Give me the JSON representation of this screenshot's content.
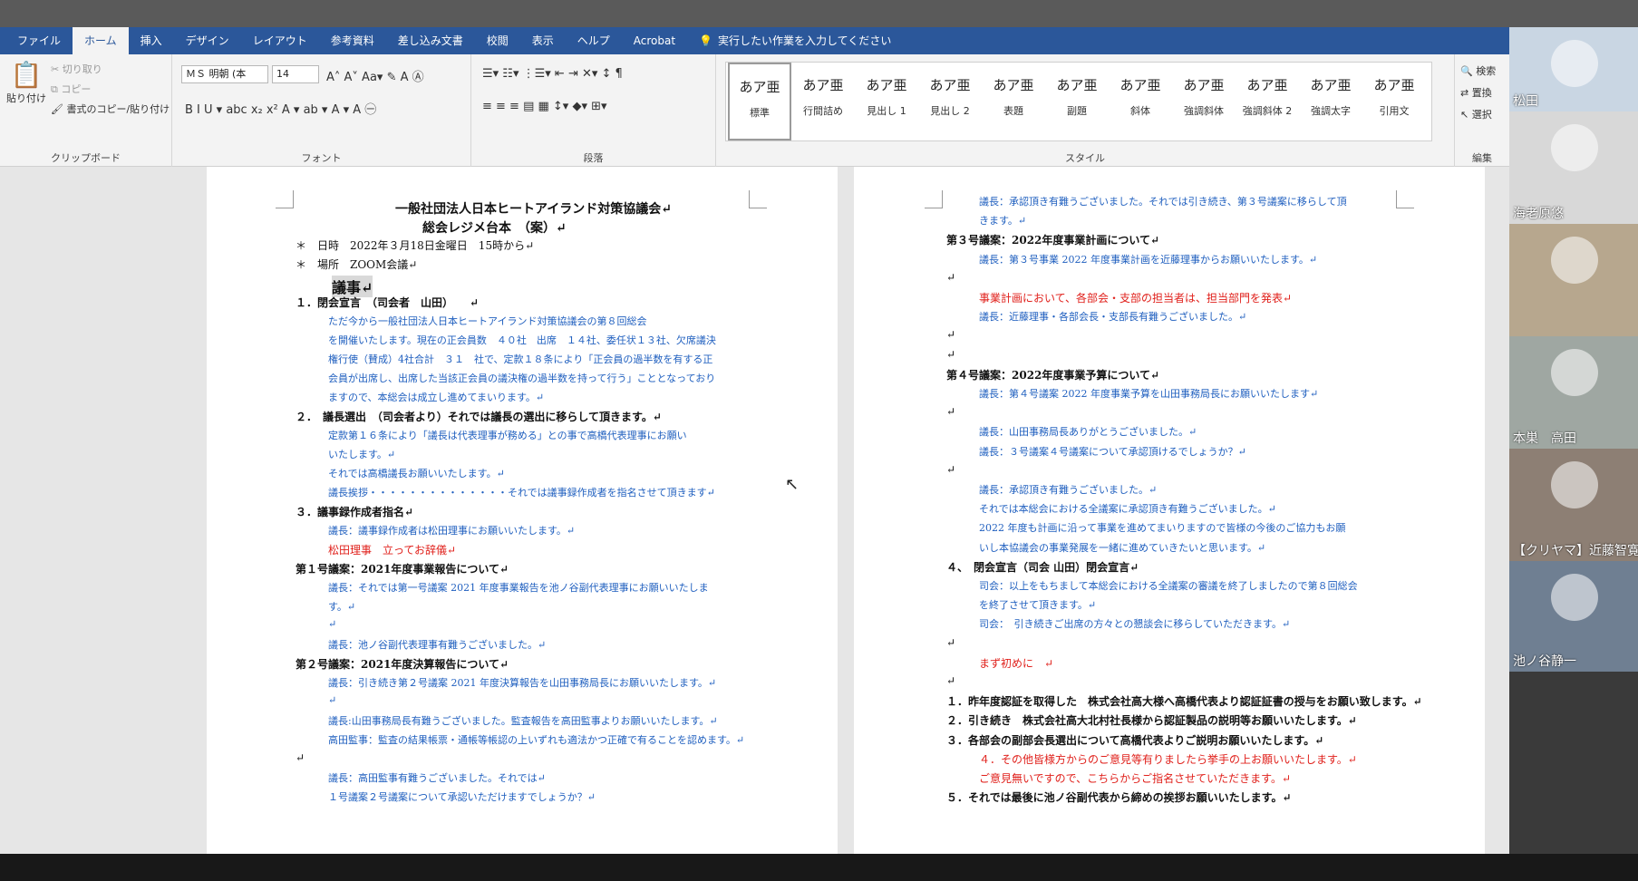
{
  "ribbon": {
    "tabs": [
      "ファイル",
      "ホーム",
      "挿入",
      "デザイン",
      "レイアウト",
      "参考資料",
      "差し込み文書",
      "校閲",
      "表示",
      "ヘルプ",
      "Acrobat"
    ],
    "tell_me": "実行したい作業を入力してください",
    "clipboard": {
      "paste": "貼り付け",
      "cut": "切り取り",
      "copy": "コピー",
      "format_painter": "書式のコピー/貼り付け",
      "label": "クリップボード"
    },
    "font": {
      "name": "ＭＳ 明朝 (本",
      "size": "14",
      "label": "フォント"
    },
    "paragraph_label": "段落",
    "styles_label": "スタイル",
    "styles": [
      {
        "sample": "あア亜",
        "name": "標準"
      },
      {
        "sample": "あア亜",
        "name": "行間詰め"
      },
      {
        "sample": "あア亜",
        "name": "見出し 1"
      },
      {
        "sample": "あア亜",
        "name": "見出し 2"
      },
      {
        "sample": "あア亜",
        "name": "表題"
      },
      {
        "sample": "あア亜",
        "name": "副題"
      },
      {
        "sample": "あア亜",
        "name": "斜体"
      },
      {
        "sample": "あア亜",
        "name": "強調斜体"
      },
      {
        "sample": "あア亜",
        "name": "強調斜体 2"
      },
      {
        "sample": "あア亜",
        "name": "強調太字"
      },
      {
        "sample": "あア亜",
        "name": "引用文"
      }
    ],
    "editing": {
      "find": "検索",
      "replace": "置換",
      "select": "選択",
      "label": "編集"
    }
  },
  "left_page": [
    {
      "text": "一般社団法人日本ヒートアイランド対策協議会↵",
      "cls": "bold"
    },
    {
      "text": "総会レジメ台本　（案）↵",
      "cls": "bold"
    },
    {
      "text": "＊　日時　2022年３月18日金曜日　15時から↵",
      "cls": ""
    },
    {
      "text": "＊　場所　ZOOM会議↵",
      "cls": ""
    },
    {
      "text": "議事↵",
      "cls": "bold"
    },
    {
      "text": "１．閉会宣言　（司会者　山田）　　↵",
      "cls": "bold"
    },
    {
      "text": "ただ今から一般社団法人日本ヒートアイランド対策協議会の第８回総会",
      "cls": "blue"
    },
    {
      "text": "を開催いたします。現在の正会員数　４０社　出席　１４社、委任状１３社、欠席議決",
      "cls": "blue"
    },
    {
      "text": "権行使（賛成）4社合計　３１　社で、定款１８条により「正会員の過半数を有する正",
      "cls": "blue"
    },
    {
      "text": "会員が出席し、出席した当該正会員の議決権の過半数を持って行う」こととなっており",
      "cls": "blue"
    },
    {
      "text": "ますので、本総会は成立し進めてまいります。↵",
      "cls": "blue"
    },
    {
      "text": "２．　議長選出　（司会者より）それでは議長の選出に移らして頂きます。↵",
      "cls": "bold"
    },
    {
      "text": "定款第１６条により「議長は代表理事が務める」との事で高橋代表理事にお願い",
      "cls": "blue"
    },
    {
      "text": "いたします。↵",
      "cls": "blue"
    },
    {
      "text": "それでは高橋議長お願いいたします。↵",
      "cls": "blue"
    },
    {
      "text": "議長挨拶・・・・・・・・・・・・・・それでは議事録作成者を指名させて頂きます↵",
      "cls": "blue"
    },
    {
      "text": "３．議事録作成者指名↵",
      "cls": "bold"
    },
    {
      "text": "議長：議事録作成者は松田理事にお願いいたします。↵",
      "cls": "blue"
    },
    {
      "text": "松田理事　立ってお辞儀↵",
      "cls": "red"
    },
    {
      "text": "第１号議案：2021年度事業報告について↵",
      "cls": "bold"
    },
    {
      "text": "議長：それでは第一号議案 2021 年度事業報告を池ノ谷副代表理事にお願いいたしま",
      "cls": "blue"
    },
    {
      "text": "す。↵",
      "cls": "blue"
    },
    {
      "text": "↵",
      "cls": "blue"
    },
    {
      "text": "議長：池ノ谷副代表理事有難うございました。↵",
      "cls": "blue"
    },
    {
      "text": "第２号議案：2021年度決算報告について↵",
      "cls": "bold"
    },
    {
      "text": "議長：引き続き第２号議案 2021 年度決算報告を山田事務局長にお願いいたします。↵",
      "cls": "blue"
    },
    {
      "text": "↵",
      "cls": "blue"
    },
    {
      "text": "議長:山田事務局長有難うございました。監査報告を高田監事よりお願いいたします。↵",
      "cls": "blue"
    },
    {
      "text": "高田監事：監査の結果帳票・通帳等帳認の上いずれも適法かつ正確で有ることを認めます。↵",
      "cls": "blue"
    },
    {
      "text": "↵",
      "cls": ""
    },
    {
      "text": "議長：高田監事有難うございました。それでは↵",
      "cls": "blue"
    },
    {
      "text": "１号議案２号議案について承認いただけますでしょうか？↵",
      "cls": "blue"
    }
  ],
  "right_page": [
    {
      "text": "議長：承認頂き有難うございました。それでは引き続き、第３号議案に移らして頂",
      "cls": "blue"
    },
    {
      "text": "きます。↵",
      "cls": "blue"
    },
    {
      "text": "第３号議案：2022年度事業計画について↵",
      "cls": "bold"
    },
    {
      "text": "議長：第３号事業 2022 年度事業計画を近藤理事からお願いいたします。↵",
      "cls": "blue"
    },
    {
      "text": "↵",
      "cls": ""
    },
    {
      "text": "事業計画において、各部会・支部の担当者は、担当部門を発表↵",
      "cls": "red"
    },
    {
      "text": "議長：近藤理事・各部会長・支部長有難うございました。↵",
      "cls": "blue"
    },
    {
      "text": "↵",
      "cls": ""
    },
    {
      "text": "↵",
      "cls": ""
    },
    {
      "text": "第４号議案：2022年度事業予算について↵",
      "cls": "bold"
    },
    {
      "text": "議長：第４号議案 2022 年度事業予算を山田事務局長にお願いいたします↵",
      "cls": "blue"
    },
    {
      "text": "↵",
      "cls": ""
    },
    {
      "text": "議長：山田事務局長ありがとうございました。↵",
      "cls": "blue"
    },
    {
      "text": "議長：３号議案４号議案について承認頂けるでしょうか？↵",
      "cls": "blue"
    },
    {
      "text": "↵",
      "cls": ""
    },
    {
      "text": "議長：承認頂き有難うございました。↵",
      "cls": "blue"
    },
    {
      "text": "それでは本総会における全議案に承認頂き有難うございました。↵",
      "cls": "blue"
    },
    {
      "text": "2022 年度も計画に沿って事業を進めてまいりますので皆様の今後のご協力もお願",
      "cls": "blue"
    },
    {
      "text": "いし本協議会の事業発展を一緒に進めていきたいと思います。↵",
      "cls": "blue"
    },
    {
      "text": "４、　閉会宣言（司会 山田）閉会宣言↵",
      "cls": "bold"
    },
    {
      "text": "司会：以上をもちまして本総会における全議案の審議を終了しましたので第８回総会",
      "cls": "blue"
    },
    {
      "text": "を終了させて頂きます。↵",
      "cls": "blue"
    },
    {
      "text": "司会：　引き続きご出席の方々との懇談会に移らしていただきます。↵",
      "cls": "blue"
    },
    {
      "text": "↵",
      "cls": ""
    },
    {
      "text": "まず初めに　↵",
      "cls": "red"
    },
    {
      "text": "↵",
      "cls": ""
    },
    {
      "text": "１．昨年度認証を取得した　株式会社高大様へ高橋代表より認証証書の授与をお願い致します。↵",
      "cls": "bold"
    },
    {
      "text": "２．引き続き　株式会社高大北村社長様から認証製品の説明等お願いいたします。↵",
      "cls": "bold"
    },
    {
      "text": "３．各部会の副部会長選出について高橋代表よりご説明お願いいたします。↵",
      "cls": "bold"
    },
    {
      "text": "４．その他皆様方からのご意見等有りましたら挙手の上お願いいたします。↵",
      "cls": "red"
    },
    {
      "text": "ご意見無いですので、こちらからご指名させていただきます。↵",
      "cls": "red"
    },
    {
      "text": "５．それでは最後に池ノ谷副代表から締めの挨拶お願いいたします。↵",
      "cls": "bold"
    }
  ],
  "participants": [
    {
      "name": "松田",
      "bg": "#c9d6e3"
    },
    {
      "name": "海老原悠",
      "bg": "#d8d8d8"
    },
    {
      "name": "",
      "bg": "#b7a78e"
    },
    {
      "name": "本巣　高田",
      "bg": "#9fa7a2"
    },
    {
      "name": "【クリヤマ】近藤智寛",
      "bg": "#8d7f74"
    },
    {
      "name": "池ノ谷静一",
      "bg": "#6f7f92"
    }
  ]
}
